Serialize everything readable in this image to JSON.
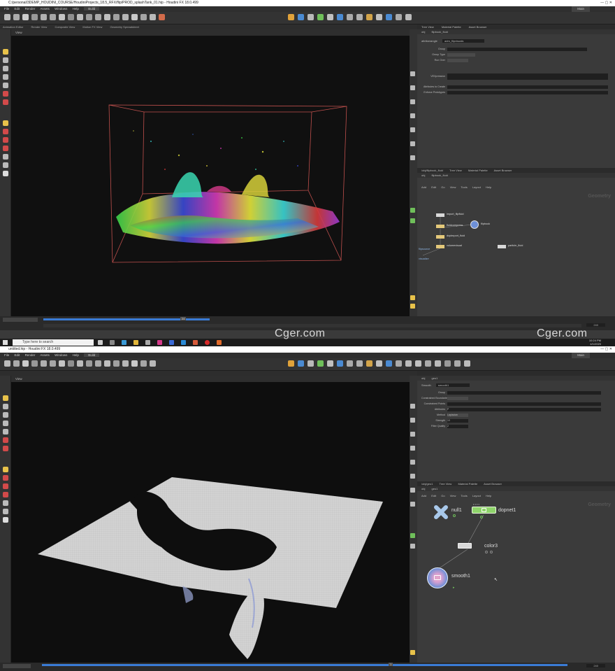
{
  "top": {
    "title": "C:/personal/3DEMP_HOUDINI_COURSE/HoudiniProjects_18.5_RFX/flip/PROD_splashTank_01.hip - Houdini FX 18.0.499",
    "menu": [
      "File",
      "Edit",
      "Render",
      "Assets",
      "Windows",
      "Help"
    ],
    "desktop": "Build",
    "context": "Main",
    "viewport_tab": "View",
    "path": [
      "obj",
      "flipbook_fluid"
    ],
    "scene_tabs": [
      "Animation Editor",
      "Render View",
      "Composite View",
      "Motion FX View",
      "Geometry Spreadsheet"
    ],
    "param_node": "attribwrangle",
    "param_node_name": "adm_flipvisuals",
    "param_tabs": [
      "Tree View",
      "Material Palette",
      "Asset Browser"
    ],
    "param_rows": [
      "Group",
      "Group Type",
      "Run Over",
      "VEXpression",
      "Attributes to Create",
      "Enforce Prototypes"
    ],
    "net_tabs": [
      "/obj/flipbook_fluid",
      "Tree View",
      "Material Palette",
      "Asset Browser"
    ],
    "net_menu": [
      "Add",
      "Edit",
      "Go",
      "View",
      "Tools",
      "Layout",
      "Help"
    ],
    "net_context": "Geometry",
    "nodes": [
      "import_flipfluid",
      "fluidcompress",
      "flipbook",
      "dopimport_fluid",
      "volumevisual",
      "particle_fluid",
      "flipsource",
      "visualize"
    ],
    "frame": "24",
    "frame_end": "240"
  },
  "taskbar": {
    "search_placeholder": "Type here to search",
    "time": "10:24 PM",
    "date": "4/1/2020"
  },
  "watermarks": [
    "Cger.com",
    "Cger.com"
  ],
  "bottom": {
    "title": "untitled.hip - Houdini FX 18.0.499",
    "menu": [
      "File",
      "Edit",
      "Render",
      "Assets",
      "Windows",
      "Help"
    ],
    "desktop": "Build",
    "context": "Main",
    "viewport_tab": "View",
    "path": [
      "obj",
      "geo1"
    ],
    "param_node": "Smooth",
    "param_node_name": "smooth1",
    "param_rows": [
      "Group",
      "Constrained Boundaries",
      "Constrained Points",
      "Attributes",
      "Method",
      "Strength",
      "Filter Quality"
    ],
    "param_values": [
      "",
      "",
      "",
      "P",
      "Laplacian",
      "10",
      "2"
    ],
    "net_tabs": [
      "/obj/geo1",
      "Tree View",
      "Material Palette",
      "Asset Browser"
    ],
    "net_menu": [
      "Add",
      "Edit",
      "Go",
      "View",
      "Tools",
      "Layout",
      "Help"
    ],
    "net_context": "Geometry",
    "nodes": {
      "null1": "null1",
      "dopnet1": "dopnet1",
      "color3": "color3",
      "smooth1": "smooth1"
    },
    "frame": "1",
    "frame_end": "240"
  },
  "colors": {
    "accent_blue": "#3a7bd5",
    "viewport_bg": "#101010",
    "bbox_red": "#c0504d",
    "dopnet_green": "#8fd46b",
    "smooth_blue": "#6d8fd6"
  }
}
